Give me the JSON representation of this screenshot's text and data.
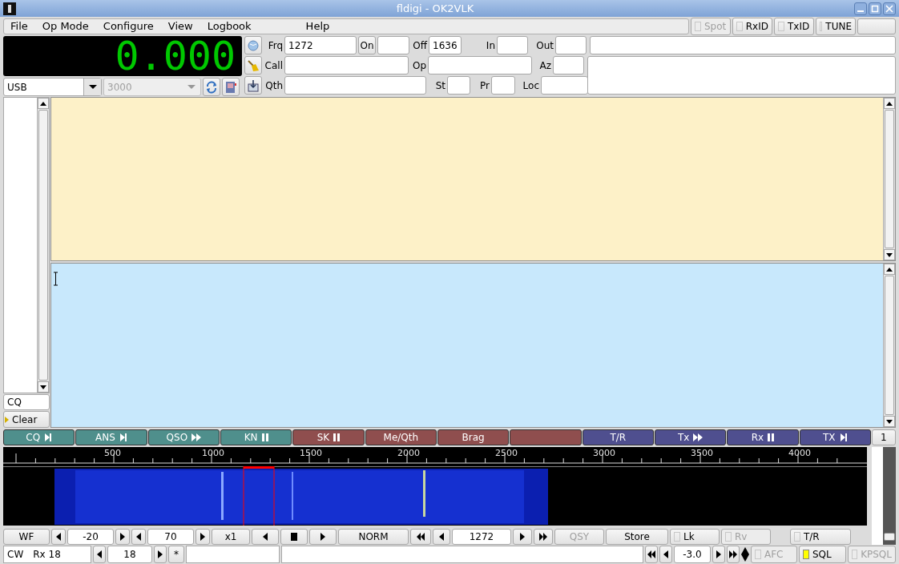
{
  "window": {
    "title": "fldigi - OK2VLK"
  },
  "menu": [
    "File",
    "Op Mode",
    "Configure",
    "View",
    "Logbook",
    "Help"
  ],
  "toggles": [
    {
      "label": "Spot",
      "checked": false,
      "disabled": true
    },
    {
      "label": "RxID",
      "checked": false,
      "disabled": false
    },
    {
      "label": "TxID",
      "checked": false,
      "disabled": false
    },
    {
      "label": "TUNE",
      "checked": false,
      "disabled": false
    }
  ],
  "frequency_display": "0.000",
  "mode": {
    "value": "USB"
  },
  "bandwidth": {
    "value": "3000",
    "disabled": true
  },
  "log_rows": [
    [
      {
        "kind": "label",
        "text": "Frq"
      },
      {
        "kind": "field",
        "value": "1272"
      },
      {
        "kind": "button",
        "text": "On"
      },
      {
        "kind": "field"
      },
      {
        "kind": "label",
        "text": "Off"
      },
      {
        "kind": "field",
        "value": "1636"
      },
      {
        "kind": "label",
        "text": "In"
      },
      {
        "kind": "field"
      },
      {
        "kind": "label",
        "text": "Out"
      },
      {
        "kind": "field"
      }
    ],
    [
      {
        "kind": "label",
        "text": "Call"
      },
      {
        "kind": "field"
      },
      {
        "kind": "label",
        "text": "Op"
      },
      {
        "kind": "field"
      },
      {
        "kind": "label",
        "text": "Az"
      },
      {
        "kind": "field"
      }
    ],
    [
      {
        "kind": "label",
        "text": "Qth"
      },
      {
        "kind": "field"
      },
      {
        "kind": "label",
        "text": "St"
      },
      {
        "kind": "field"
      },
      {
        "kind": "label",
        "text": "Pr"
      },
      {
        "kind": "field"
      },
      {
        "kind": "label",
        "text": "Loc"
      },
      {
        "kind": "field"
      }
    ]
  ],
  "left_panel": {
    "entry": "CQ",
    "clear_button": "Clear"
  },
  "macros": [
    {
      "label": "CQ",
      "kind": "end",
      "color": "#4f8f8c"
    },
    {
      "label": "ANS",
      "kind": "end",
      "color": "#4f8f8c"
    },
    {
      "label": "QSO",
      "kind": "ff",
      "color": "#4f8f8c"
    },
    {
      "label": "KN",
      "kind": "pause",
      "color": "#4f8f8c"
    },
    {
      "label": "SK",
      "kind": "pause",
      "color": "#8f4e4e"
    },
    {
      "label": "Me/Qth",
      "kind": "plain",
      "color": "#8f4e4e"
    },
    {
      "label": "Brag",
      "kind": "plain",
      "color": "#8f4e4e"
    },
    {
      "kind": "plain",
      "color": "#8f4e4e"
    },
    {
      "label": "T/R",
      "kind": "plain",
      "color": "#4f4f8f"
    },
    {
      "label": "Tx",
      "kind": "ff",
      "color": "#4f4f8f"
    },
    {
      "label": "Rx",
      "kind": "pause",
      "color": "#4f4f8f"
    },
    {
      "label": "TX",
      "kind": "end",
      "color": "#4f4f8f"
    }
  ],
  "macro_set": "1",
  "waterfall_slider": {
    "level": 0.05
  },
  "scale_labels": [
    "500",
    "1000",
    "1500",
    "2000",
    "2500",
    "3000",
    "3500",
    "4000"
  ],
  "controls": {
    "display_button": "WF",
    "min_db": "-20",
    "range_db": "70",
    "zoom": "x1",
    "speed": "NORM",
    "frequency": "1272",
    "qsy": {
      "label": "QSY",
      "disabled": true
    },
    "store": "Store",
    "lock": {
      "label": "Lk",
      "checked": false,
      "disabled": false
    },
    "reverse": {
      "label": "Rv",
      "checked": false,
      "disabled": true
    },
    "tr": {
      "label": "T/R",
      "checked": false,
      "disabled": false
    }
  },
  "status_bar": {
    "mode": "CW",
    "rx_status": "Rx 18",
    "squelch_level": "18",
    "star": "*",
    "afc_value": "-3.0",
    "afc": {
      "label": "AFC",
      "checked": false,
      "disabled": true
    },
    "sql": {
      "label": "SQL",
      "checked": true,
      "disabled": false
    },
    "kpsql": {
      "label": "KPSQL",
      "checked": false,
      "disabled": true
    }
  }
}
